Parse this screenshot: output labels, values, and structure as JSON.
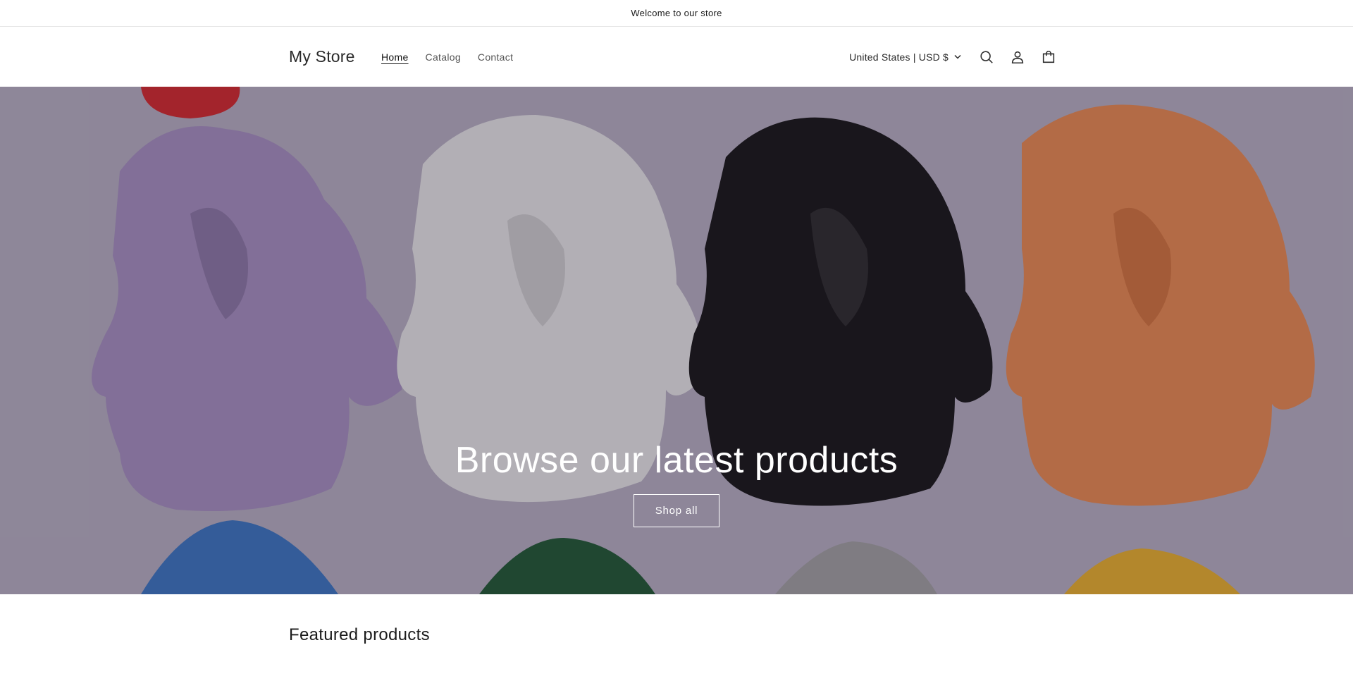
{
  "announcement": {
    "text": "Welcome to our store"
  },
  "header": {
    "logo": "My Store",
    "nav": [
      {
        "label": "Home",
        "active": true
      },
      {
        "label": "Catalog",
        "active": false
      },
      {
        "label": "Contact",
        "active": false
      }
    ],
    "localization": "United States | USD $",
    "icons": [
      "search-icon",
      "account-icon",
      "cart-icon",
      "chevron-down-icon"
    ]
  },
  "hero": {
    "title": "Browse our latest products",
    "button": "Shop all"
  },
  "featured": {
    "title": "Featured products"
  },
  "colors": {
    "text": "#121212",
    "hoodie_purple": "#a993c4",
    "hoodie_white": "#efefef",
    "hoodie_black": "#141414",
    "hoodie_orange": "#f08d4f",
    "hoodie_red": "#d8282a",
    "hoodie_blue": "#3a77c6",
    "hoodie_green": "#1e5a32",
    "hoodie_grey": "#a5a5a5",
    "hoodie_yellow": "#f0b52a"
  }
}
